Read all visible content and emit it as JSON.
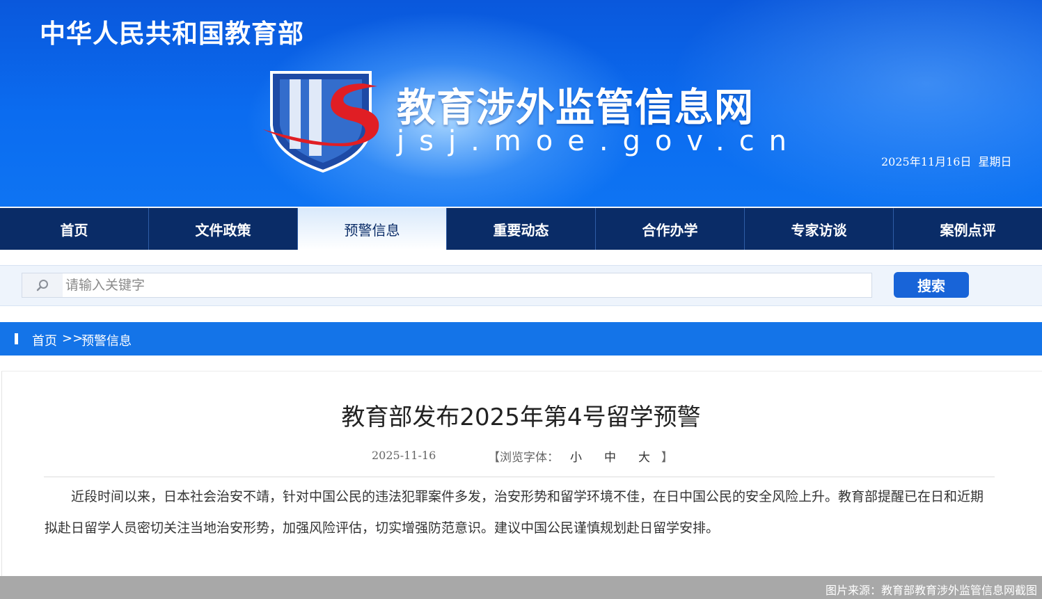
{
  "banner": {
    "ministry": "中华人民共和国教育部",
    "site_title": "教育涉外监管信息网",
    "site_domain": "jsj.moe.gov.cn",
    "date": "2025年11月16日",
    "weekday": "星期日",
    "emblem_icon": "jsj-shield-logo",
    "colors": {
      "background": "#0b6cf0",
      "emblem_red": "#e01e24",
      "emblem_blue": "#1d4aa6"
    }
  },
  "nav": {
    "items": [
      {
        "label": "首页"
      },
      {
        "label": "文件政策"
      },
      {
        "label": "预警信息",
        "active": true
      },
      {
        "label": "重要动态"
      },
      {
        "label": "合作办学"
      },
      {
        "label": "专家访谈"
      },
      {
        "label": "案例点评"
      }
    ],
    "colors": {
      "background": "#0a2c67",
      "active_text": "#0a2c67"
    }
  },
  "search": {
    "placeholder": "请输入关键字",
    "value": "",
    "button_label": "搜索",
    "icon": "search-icon"
  },
  "breadcrumb": {
    "home": "首页",
    "separator": ">>",
    "current": "预警信息"
  },
  "article": {
    "title": "教育部发布2025年第4号留学预警",
    "date": "2025-11-16",
    "font_label_open": "【浏览字体：",
    "font_small": "小",
    "font_medium": "中",
    "font_large": "大",
    "font_label_close": "】",
    "body": "近段时间以来，日本社会治安不靖，针对中国公民的违法犯罪案件多发，治安形势和留学环境不佳，在日中国公民的安全风险上升。教育部提醒已在日和近期拟赴日留学人员密切关注当地治安形势，加强风险评估，切实增强防范意识。建议中国公民谨慎规划赴日留学安排。"
  },
  "footer": {
    "caption": "图片来源：教育部教育涉外监管信息网截图"
  }
}
